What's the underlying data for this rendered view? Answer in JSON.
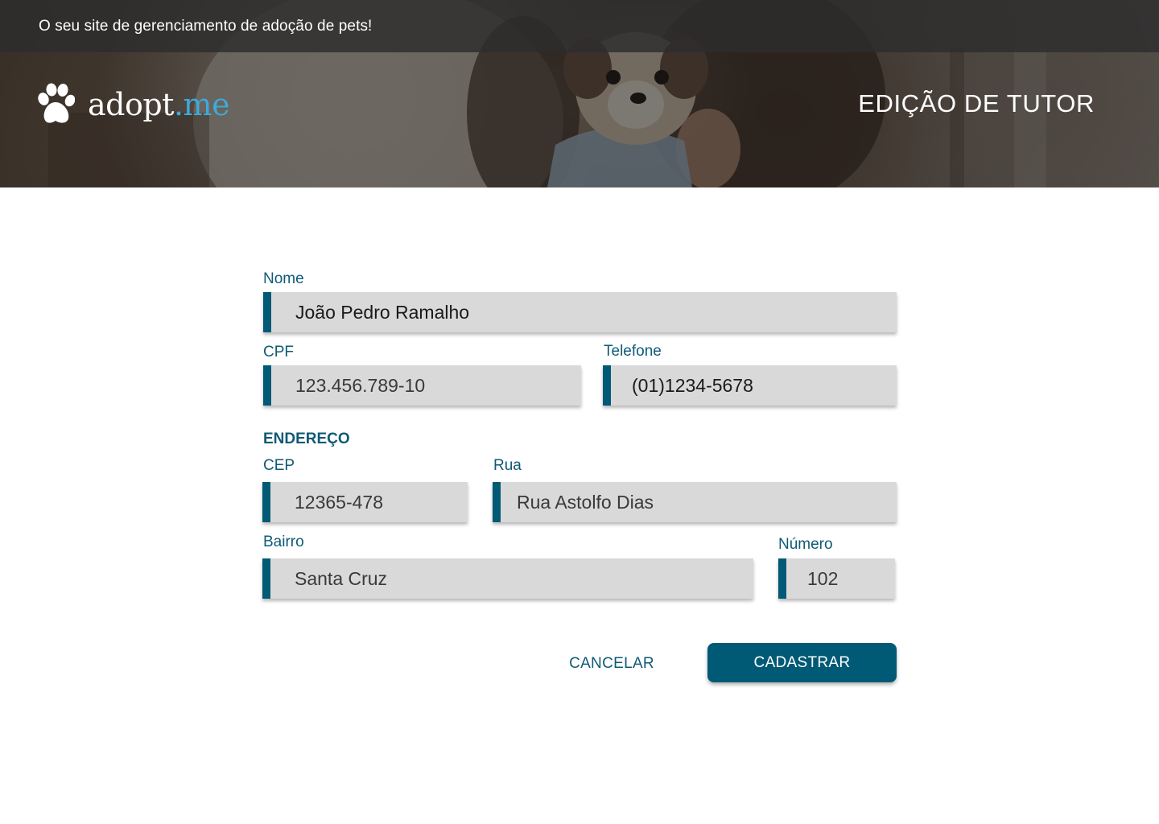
{
  "header": {
    "tagline": "O seu site de gerenciamento de adoção de pets!",
    "logo": {
      "text_main": "adopt",
      "text_dot": ".me",
      "icon": "paw-icon"
    },
    "page_title": "EDIÇÃO DE TUTOR"
  },
  "form": {
    "nome": {
      "label": "Nome",
      "value": "João Pedro Ramalho"
    },
    "cpf": {
      "label": "CPF",
      "value": "123.456.789-10"
    },
    "telefone": {
      "label": "Telefone",
      "value": "(01)1234-5678"
    },
    "endereco_title": "ENDEREÇO",
    "cep": {
      "label": "CEP",
      "value": "12365-478"
    },
    "rua": {
      "label": "Rua",
      "value": "Rua Astolfo Dias"
    },
    "bairro": {
      "label": "Bairro",
      "value": "Santa Cruz"
    },
    "numero": {
      "label": "Número",
      "value": "102"
    }
  },
  "actions": {
    "cancel_label": "CANCELAR",
    "submit_label": "CADASTRAR"
  },
  "colors": {
    "accent": "#005a75",
    "label": "#0f5a76",
    "field_bg": "#d9d9d9",
    "logo_dot": "#3fa9d8"
  }
}
